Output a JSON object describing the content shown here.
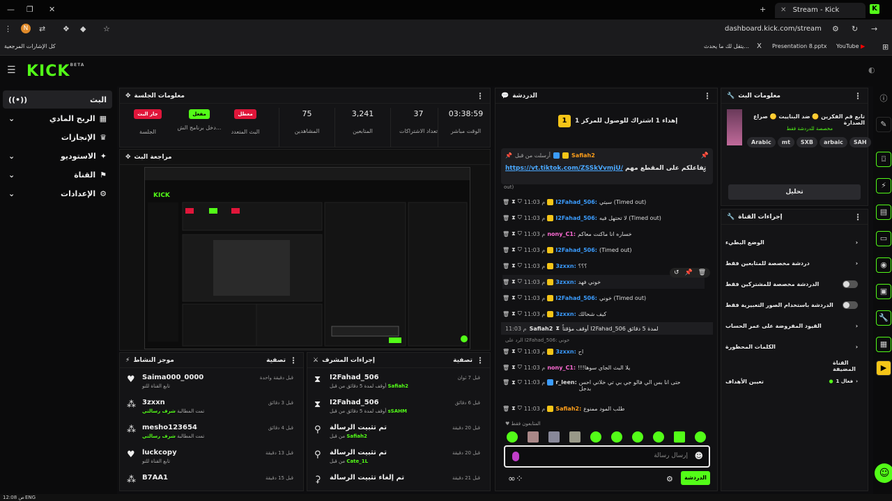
{
  "browser": {
    "tab_title": "Stream - Kick Dashboard",
    "url": "dashboard.kick.com/stream",
    "profile_initial": "N",
    "bookmarks": [
      "YouTube",
      "Presentation 8.pptx",
      "يتقل لك ما يحدث...",
      "كل الإشارات المرجعية"
    ]
  },
  "kick": {
    "logo": "KICK",
    "logo_sup": "BETA"
  },
  "sidebar": {
    "items": [
      {
        "label": "البث",
        "icon": "broadcast-icon"
      },
      {
        "label": "الربح المادي",
        "icon": "money-icon"
      },
      {
        "label": "الإنجازات",
        "icon": "trophy-icon"
      },
      {
        "label": "الاستوديو",
        "icon": "studio-icon"
      },
      {
        "label": "القناة",
        "icon": "channel-icon"
      },
      {
        "label": "الإعدادات",
        "icon": "gear-icon"
      }
    ]
  },
  "session": {
    "title": "معلومات الجلسة",
    "badges": [
      {
        "label": "جار البث",
        "sub": "الجلسة",
        "color": "#e0163a"
      },
      {
        "label": "مفعل",
        "sub": "دخل برنامج الش...",
        "color": "#53fc18"
      },
      {
        "label": "معطل",
        "sub": "البث المتعدد",
        "color": "#e0163a"
      }
    ],
    "stats": [
      {
        "value": "75",
        "label": "المشاهدين"
      },
      {
        "value": "3,241",
        "label": "المتابعين"
      },
      {
        "value": "37",
        "label": "تعداد الاشتراكات"
      },
      {
        "value": "03:38:59",
        "label": "الوقت مباشر"
      }
    ]
  },
  "preview": {
    "title": "مراجعة البث"
  },
  "activity": {
    "title": "موجز النشاط",
    "filter": "تصفية",
    "rows": [
      {
        "name": "Saima000_0000",
        "sub": "تابع القناة للتو",
        "time": "قبل دقيقة واحدة",
        "icon": "heart-icon"
      },
      {
        "name": "3zxxn",
        "sub": "تمت المطالبة",
        "sub_b": "شرف رسالتي",
        "time": "قبل 3 دقائق",
        "icon": "sparkle-icon"
      },
      {
        "name": "mesho123654",
        "sub": "تمت المطالبة",
        "sub_b": "شرف رسالتي",
        "time": "قبل 4 دقائق",
        "icon": "sparkle-icon"
      },
      {
        "name": "luckcopy",
        "sub": "تابع القناة للتو",
        "time": "قبل 13 دقيقة",
        "icon": "heart-icon"
      },
      {
        "name": "B7AA1",
        "sub": "",
        "time": "قبل 15 دقيقة",
        "icon": "sparkle-icon"
      }
    ]
  },
  "mod": {
    "title": "إجراءات المشرف",
    "filter": "تصفية",
    "rows": [
      {
        "name": "I2Fahad_506",
        "sub": "أوقف لمدة 5 دقائق من قبل",
        "sub_b": "Safiah2",
        "time": "قبل 7 ثوان",
        "icon": "hourglass-icon"
      },
      {
        "name": "I2Fahad_506",
        "sub": "أوقف لمدة 5 دقائق من قبل",
        "sub_b": "sSAHM",
        "time": "قبل 6 دقائق",
        "icon": "hourglass-icon"
      },
      {
        "name": "تم تثبيت الرسالة",
        "sub": "من قبل",
        "sub_b": "Safiah2",
        "time": "قبل 20 دقيقة",
        "icon": "pin-icon"
      },
      {
        "name": "تم تثبيت الرسالة",
        "sub": "من قبل",
        "sub_b": "Cate_1L",
        "time": "قبل 20 دقيقة",
        "icon": "pin-icon"
      },
      {
        "name": "تم إلغاء تثبيت الرسالة",
        "sub": "",
        "time": "قبل 21 دقيقة",
        "icon": "unpin-icon"
      }
    ]
  },
  "chat": {
    "title": "الدردشة",
    "goal_text": "إهداء 1 اشتراك للوصول للمركز 1",
    "goal_rank": "1",
    "pinned_user": "Safiah2",
    "pinned_by": "أرسلت من قبل",
    "pinned_text": "https://vt.tiktok.com/ZSSkVvmjU/",
    "pinned_suffix": "تفاعلكم على المقطع مهم",
    "out_note": "out)",
    "messages": [
      {
        "time": "11:03 م",
        "user": "I2Fahad_506:",
        "text": "سيتي (Timed out)",
        "color": "#3b9cff"
      },
      {
        "time": "11:03 م",
        "user": "I2Fahad_506:",
        "text": "لا تحتهل فيه (Timed out)",
        "color": "#3b9cff"
      },
      {
        "time": "11:03 م",
        "user": "nony_C1:",
        "text": "خساره انا ماكنت معاكم",
        "color": "#ff6bd5"
      },
      {
        "time": "11:03 م",
        "user": "I2Fahad_506:",
        "text": "(Timed out)",
        "color": "#3b9cff"
      },
      {
        "time": "11:03 م",
        "user": "3zxxn:",
        "text": "؟؟؟",
        "color": "#3b9cff"
      },
      {
        "time": "11:03 م",
        "user": "3zxxn:",
        "text": "خوني فهد",
        "color": "#3b9cff"
      },
      {
        "time": "11:03 م",
        "user": "I2Fahad_506:",
        "text": "خوني (Timed out)",
        "color": "#3b9cff"
      },
      {
        "time": "11:03 م",
        "user": "3zxxn:",
        "text": "كيف شحالك",
        "color": "#3b9cff"
      }
    ],
    "system_msg": "أوقف مؤقتاً I2Fahad_506 لمدة 5 دقائق",
    "system_user": "Safiah2",
    "system_time": "11:03 م",
    "reply_note": "الرد على I2Fahad_506: خوني",
    "messages2": [
      {
        "time": "11:03 م",
        "user": "3zxxn:",
        "text": "اح",
        "color": "#3b9cff"
      },
      {
        "time": "11:03 م",
        "user": "nony_C1:",
        "text": "!!!يلا البث الجاي سوها",
        "color": "#ff6bd5"
      },
      {
        "time": "11:03 م",
        "user": "r_leen:",
        "text": "حتى انا بس الي فالو جي بي تي خلاني احس بدجل",
        "color": "#eee"
      },
      {
        "time": "11:03 م",
        "user": "Safiah2:",
        "text": "طلب المود ممنوع",
        "color": "#ff9f1a"
      }
    ],
    "followers_only": "المتابعون فقط",
    "input_placeholder": "إرسال رسالة",
    "send_label": "الدردشة"
  },
  "stream_info": {
    "title": "معلومات البث",
    "stream_title": "تابع قم الفكرين 🟡 ضد البناييت 🟡 صراع الصدارة",
    "category": "مخصصة للدردشة فقط",
    "tags": [
      "SAH",
      "arbaic",
      "SXB",
      "mt",
      "Arabic"
    ],
    "edit_label": "تحليل"
  },
  "channel_actions": {
    "title": "إجراءات القناة",
    "items": [
      {
        "label": "الوضع البطيء",
        "type": "arrow"
      },
      {
        "label": "دردشة مخصصة للمتابعين فقط",
        "type": "arrow"
      },
      {
        "label": "الدردشة مخصصة للمشتركين فقط",
        "type": "toggle"
      },
      {
        "label": "الدردشة باستخدام الصور التعبيرية فقط",
        "type": "toggle"
      },
      {
        "label": "القيود المفروضة على عمر الحساب",
        "type": "arrow"
      },
      {
        "label": "الكلمات المحظورة",
        "type": "arrow"
      }
    ],
    "host_label": "القناة المضيفة",
    "goals_label": "تعيين الأهداف",
    "goals_value": "فعال 1"
  },
  "taskbar": {
    "lang": "ENG",
    "time": "12:08 ص"
  }
}
